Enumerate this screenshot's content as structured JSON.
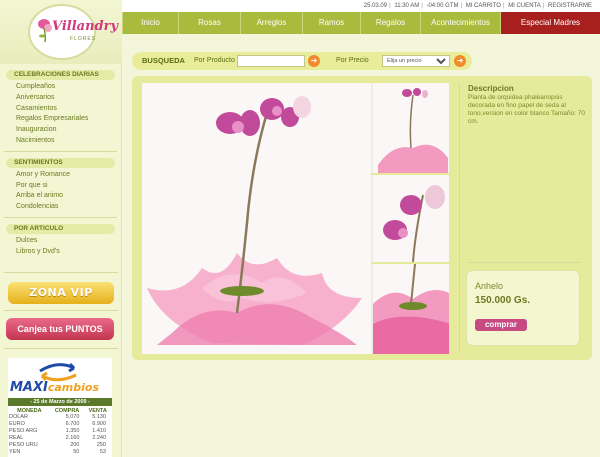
{
  "logo": {
    "brand": "Villandry",
    "sub": "FLORES"
  },
  "topbar": {
    "date": "25.03.09",
    "time": "11:30 AM",
    "timezone": "-04:00 GTM",
    "cart": "MI CARRITO",
    "account": "MI CUENTA",
    "register": "REGISTRARME"
  },
  "nav": {
    "tabs": [
      "Inicio",
      "Rosas",
      "Arreglos",
      "Ramos",
      "Regalos",
      "Acontecimientos"
    ],
    "special": "Especial Madres"
  },
  "sidebar": {
    "sections": [
      {
        "title": "CELEBRACIONES DIARIAS",
        "items": [
          "Cumpleaños",
          "Aniversarios",
          "Casamientos",
          "Regalos Empresariales",
          "Inauguracion",
          "Nacimientos"
        ]
      },
      {
        "title": "SENTIMIENTOS",
        "items": [
          "Amor y Romance",
          "Por que si",
          "Arriba el animo",
          "Condolencias"
        ]
      },
      {
        "title": "POR ARTICULO",
        "items": [
          "Dulces",
          "Libros y Dvd's"
        ]
      }
    ],
    "zona_vip": "ZONA VIP",
    "canjea": "Canjea tus PUNTOS"
  },
  "maxicambios": {
    "logo_main": "MAXI",
    "logo_sub": "cambios",
    "date": "- 25 de Marzo de 2009 -",
    "headers": [
      "MONEDA",
      "COMPRA",
      "VENTA"
    ],
    "rows": [
      [
        "DOLAR",
        "5.070",
        "5.130"
      ],
      [
        "EURO",
        "6.700",
        "6.900"
      ],
      [
        "PESO ARG",
        "1.350",
        "1.410"
      ],
      [
        "REAL",
        "2.160",
        "2.240"
      ],
      [
        "PESO URU",
        "200",
        "250"
      ],
      [
        "YEN",
        "50",
        "53"
      ]
    ]
  },
  "search": {
    "label": "BUSQUEDA",
    "by_product": "Por Producto",
    "by_price": "Por Precio",
    "price_select": "Elija un precio"
  },
  "product": {
    "desc_title": "Descripcion",
    "description": "Planta de orquidea phaleanopsis decorada en fino papel de seda al tono,version en color blanco Tamaño: 70 cm.",
    "name": "Anhelo",
    "price": "150.000 Gs.",
    "buy_label": "comprar"
  },
  "colors": {
    "nav_green": "#a9bb3c",
    "special_red": "#a8201e",
    "buy_pink": "#c84a82",
    "orchid": "#c24a9a"
  }
}
